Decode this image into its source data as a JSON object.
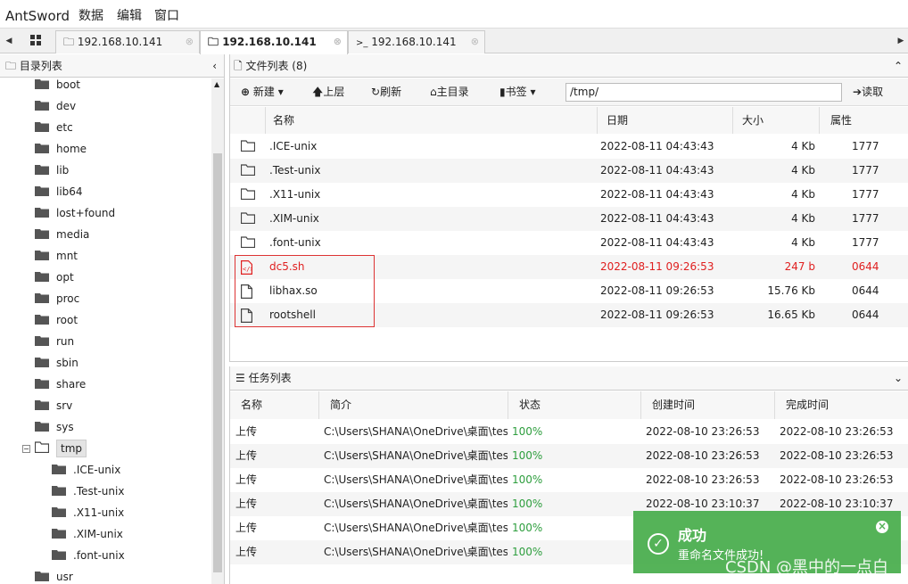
{
  "app": {
    "brand": "AntSword",
    "menu": [
      "数据",
      "编辑",
      "窗口"
    ]
  },
  "tabs": [
    {
      "label": "192.168.10.141",
      "icon": "folder-icon",
      "active": false
    },
    {
      "label": "192.168.10.141",
      "icon": "folder-icon",
      "active": true
    },
    {
      "label": "192.168.10.141",
      "icon": "terminal-icon",
      "active": false
    }
  ],
  "tab_close": "⊗",
  "sidebar": {
    "title": "目录列表",
    "items": [
      "boot",
      "dev",
      "etc",
      "home",
      "lib",
      "lib64",
      "lost+found",
      "media",
      "mnt",
      "opt",
      "proc",
      "root",
      "run",
      "sbin",
      "share",
      "srv",
      "sys",
      "tmp"
    ],
    "tmp_children": [
      ".ICE-unix",
      ".Test-unix",
      ".X11-unix",
      ".XIM-unix",
      ".font-unix"
    ],
    "after": "usr"
  },
  "files": {
    "title": "文件列表 (8)",
    "toolbar": {
      "new": "新建",
      "up": "上层",
      "refresh": "刷新",
      "home": "主目录",
      "bookmark": "书签",
      "path": "/tmp/",
      "read": "读取"
    },
    "columns": [
      "名称",
      "日期",
      "大小",
      "属性"
    ],
    "rows": [
      {
        "name": ".ICE-unix",
        "date": "2022-08-11 04:43:43",
        "size": "4 Kb",
        "perm": "1777",
        "type": "folder"
      },
      {
        "name": ".Test-unix",
        "date": "2022-08-11 04:43:43",
        "size": "4 Kb",
        "perm": "1777",
        "type": "folder"
      },
      {
        "name": ".X11-unix",
        "date": "2022-08-11 04:43:43",
        "size": "4 Kb",
        "perm": "1777",
        "type": "folder"
      },
      {
        "name": ".XIM-unix",
        "date": "2022-08-11 04:43:43",
        "size": "4 Kb",
        "perm": "1777",
        "type": "folder"
      },
      {
        "name": ".font-unix",
        "date": "2022-08-11 04:43:43",
        "size": "4 Kb",
        "perm": "1777",
        "type": "folder"
      },
      {
        "name": "dc5.sh",
        "date": "2022-08-11 09:26:53",
        "size": "247 b",
        "perm": "0644",
        "type": "script"
      },
      {
        "name": "libhax.so",
        "date": "2022-08-11 09:26:53",
        "size": "15.76 Kb",
        "perm": "0644",
        "type": "file"
      },
      {
        "name": "rootshell",
        "date": "2022-08-11 09:26:53",
        "size": "16.65 Kb",
        "perm": "0644",
        "type": "file"
      }
    ],
    "highlight_color": "#e02020"
  },
  "tasks": {
    "title": "任务列表",
    "columns": [
      "名称",
      "简介",
      "状态",
      "创建时间",
      "完成时间"
    ],
    "rows": [
      {
        "name": "上传",
        "desc": "C:\\Users\\SHANA\\OneDrive\\桌面\\test",
        "status": "100%",
        "created": "2022-08-10 23:26:53",
        "done": "2022-08-10 23:26:53"
      },
      {
        "name": "上传",
        "desc": "C:\\Users\\SHANA\\OneDrive\\桌面\\test",
        "status": "100%",
        "created": "2022-08-10 23:26:53",
        "done": "2022-08-10 23:26:53"
      },
      {
        "name": "上传",
        "desc": "C:\\Users\\SHANA\\OneDrive\\桌面\\test",
        "status": "100%",
        "created": "2022-08-10 23:26:53",
        "done": "2022-08-10 23:26:53"
      },
      {
        "name": "上传",
        "desc": "C:\\Users\\SHANA\\OneDrive\\桌面\\test",
        "status": "100%",
        "created": "2022-08-10 23:10:37",
        "done": "2022-08-10 23:10:37"
      },
      {
        "name": "上传",
        "desc": "C:\\Users\\SHANA\\OneDrive\\桌面\\test",
        "status": "100%",
        "created": "",
        "done": ""
      },
      {
        "name": "上传",
        "desc": "C:\\Users\\SHANA\\OneDrive\\桌面\\test",
        "status": "100%",
        "created": "",
        "done": ""
      }
    ]
  },
  "toast": {
    "title": "成功",
    "message": "重命名文件成功!",
    "close": "×",
    "check": "✓"
  },
  "watermark": "CSDN @黑中的一点白"
}
